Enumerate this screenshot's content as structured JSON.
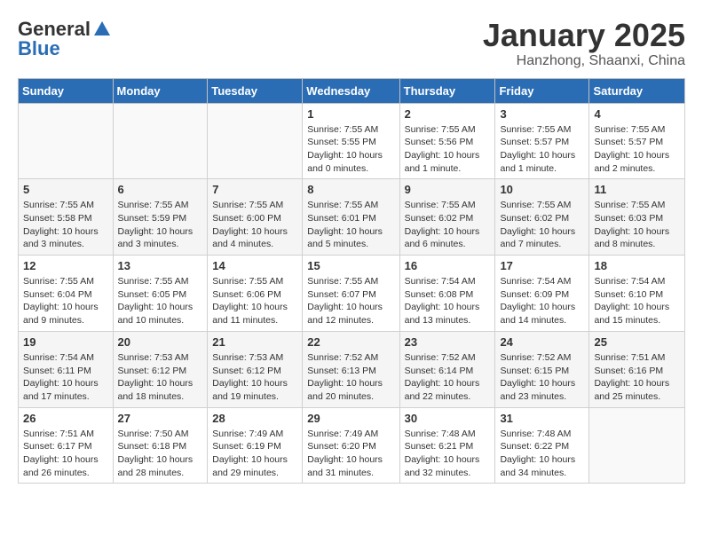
{
  "header": {
    "logo_general": "General",
    "logo_blue": "Blue",
    "title": "January 2025",
    "subtitle": "Hanzhong, Shaanxi, China"
  },
  "days_of_week": [
    "Sunday",
    "Monday",
    "Tuesday",
    "Wednesday",
    "Thursday",
    "Friday",
    "Saturday"
  ],
  "weeks": [
    [
      {
        "day": "",
        "info": ""
      },
      {
        "day": "",
        "info": ""
      },
      {
        "day": "",
        "info": ""
      },
      {
        "day": "1",
        "info": "Sunrise: 7:55 AM\nSunset: 5:55 PM\nDaylight: 10 hours\nand 0 minutes."
      },
      {
        "day": "2",
        "info": "Sunrise: 7:55 AM\nSunset: 5:56 PM\nDaylight: 10 hours\nand 1 minute."
      },
      {
        "day": "3",
        "info": "Sunrise: 7:55 AM\nSunset: 5:57 PM\nDaylight: 10 hours\nand 1 minute."
      },
      {
        "day": "4",
        "info": "Sunrise: 7:55 AM\nSunset: 5:57 PM\nDaylight: 10 hours\nand 2 minutes."
      }
    ],
    [
      {
        "day": "5",
        "info": "Sunrise: 7:55 AM\nSunset: 5:58 PM\nDaylight: 10 hours\nand 3 minutes."
      },
      {
        "day": "6",
        "info": "Sunrise: 7:55 AM\nSunset: 5:59 PM\nDaylight: 10 hours\nand 3 minutes."
      },
      {
        "day": "7",
        "info": "Sunrise: 7:55 AM\nSunset: 6:00 PM\nDaylight: 10 hours\nand 4 minutes."
      },
      {
        "day": "8",
        "info": "Sunrise: 7:55 AM\nSunset: 6:01 PM\nDaylight: 10 hours\nand 5 minutes."
      },
      {
        "day": "9",
        "info": "Sunrise: 7:55 AM\nSunset: 6:02 PM\nDaylight: 10 hours\nand 6 minutes."
      },
      {
        "day": "10",
        "info": "Sunrise: 7:55 AM\nSunset: 6:02 PM\nDaylight: 10 hours\nand 7 minutes."
      },
      {
        "day": "11",
        "info": "Sunrise: 7:55 AM\nSunset: 6:03 PM\nDaylight: 10 hours\nand 8 minutes."
      }
    ],
    [
      {
        "day": "12",
        "info": "Sunrise: 7:55 AM\nSunset: 6:04 PM\nDaylight: 10 hours\nand 9 minutes."
      },
      {
        "day": "13",
        "info": "Sunrise: 7:55 AM\nSunset: 6:05 PM\nDaylight: 10 hours\nand 10 minutes."
      },
      {
        "day": "14",
        "info": "Sunrise: 7:55 AM\nSunset: 6:06 PM\nDaylight: 10 hours\nand 11 minutes."
      },
      {
        "day": "15",
        "info": "Sunrise: 7:55 AM\nSunset: 6:07 PM\nDaylight: 10 hours\nand 12 minutes."
      },
      {
        "day": "16",
        "info": "Sunrise: 7:54 AM\nSunset: 6:08 PM\nDaylight: 10 hours\nand 13 minutes."
      },
      {
        "day": "17",
        "info": "Sunrise: 7:54 AM\nSunset: 6:09 PM\nDaylight: 10 hours\nand 14 minutes."
      },
      {
        "day": "18",
        "info": "Sunrise: 7:54 AM\nSunset: 6:10 PM\nDaylight: 10 hours\nand 15 minutes."
      }
    ],
    [
      {
        "day": "19",
        "info": "Sunrise: 7:54 AM\nSunset: 6:11 PM\nDaylight: 10 hours\nand 17 minutes."
      },
      {
        "day": "20",
        "info": "Sunrise: 7:53 AM\nSunset: 6:12 PM\nDaylight: 10 hours\nand 18 minutes."
      },
      {
        "day": "21",
        "info": "Sunrise: 7:53 AM\nSunset: 6:12 PM\nDaylight: 10 hours\nand 19 minutes."
      },
      {
        "day": "22",
        "info": "Sunrise: 7:52 AM\nSunset: 6:13 PM\nDaylight: 10 hours\nand 20 minutes."
      },
      {
        "day": "23",
        "info": "Sunrise: 7:52 AM\nSunset: 6:14 PM\nDaylight: 10 hours\nand 22 minutes."
      },
      {
        "day": "24",
        "info": "Sunrise: 7:52 AM\nSunset: 6:15 PM\nDaylight: 10 hours\nand 23 minutes."
      },
      {
        "day": "25",
        "info": "Sunrise: 7:51 AM\nSunset: 6:16 PM\nDaylight: 10 hours\nand 25 minutes."
      }
    ],
    [
      {
        "day": "26",
        "info": "Sunrise: 7:51 AM\nSunset: 6:17 PM\nDaylight: 10 hours\nand 26 minutes."
      },
      {
        "day": "27",
        "info": "Sunrise: 7:50 AM\nSunset: 6:18 PM\nDaylight: 10 hours\nand 28 minutes."
      },
      {
        "day": "28",
        "info": "Sunrise: 7:49 AM\nSunset: 6:19 PM\nDaylight: 10 hours\nand 29 minutes."
      },
      {
        "day": "29",
        "info": "Sunrise: 7:49 AM\nSunset: 6:20 PM\nDaylight: 10 hours\nand 31 minutes."
      },
      {
        "day": "30",
        "info": "Sunrise: 7:48 AM\nSunset: 6:21 PM\nDaylight: 10 hours\nand 32 minutes."
      },
      {
        "day": "31",
        "info": "Sunrise: 7:48 AM\nSunset: 6:22 PM\nDaylight: 10 hours\nand 34 minutes."
      },
      {
        "day": "",
        "info": ""
      }
    ]
  ]
}
